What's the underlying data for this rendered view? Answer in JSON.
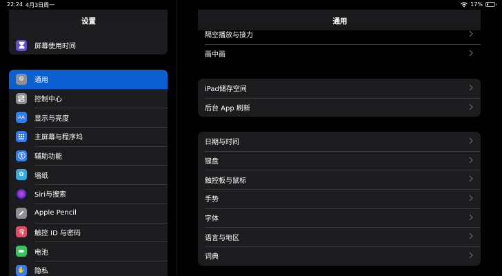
{
  "status": {
    "time": "22:24",
    "date": "4月3日周一",
    "battery": "17%"
  },
  "sidebar": {
    "title": "设置",
    "group1": [
      {
        "label": "屏幕使用时间",
        "icon": "hourglass-icon",
        "color": "#5e4fd4"
      }
    ],
    "group2": [
      {
        "label": "通用",
        "icon": "gear-icon",
        "color": "#8e8e93"
      },
      {
        "label": "控制中心",
        "icon": "switches-icon",
        "color": "#8e8e93"
      },
      {
        "label": "显示与亮度",
        "icon": "text-size-icon",
        "color": "#2f7ef5"
      },
      {
        "label": "主屏幕与程序坞",
        "icon": "grid-icon",
        "color": "#2f7ef5"
      },
      {
        "label": "辅助功能",
        "icon": "accessibility-icon",
        "color": "#2f7ef5"
      },
      {
        "label": "墙纸",
        "icon": "flower-icon",
        "color": "#35aadc"
      },
      {
        "label": "Siri与搜索",
        "icon": "siri-icon",
        "color": "#222"
      },
      {
        "label": "Apple Pencil",
        "icon": "pencil-icon",
        "color": "#8e8e93"
      },
      {
        "label": "触控 ID 与密码",
        "icon": "fingerprint-icon",
        "color": "#e94a5e"
      },
      {
        "label": "电池",
        "icon": "battery-icon",
        "color": "#34c759"
      },
      {
        "label": "隐私",
        "icon": "hand-icon",
        "color": "#2f7ef5"
      }
    ]
  },
  "detail": {
    "title": "通用",
    "group1": [
      "隔空播放与接力",
      "画中画"
    ],
    "group2": [
      "iPad储存空间",
      "后台 App 刷新"
    ],
    "group3": [
      "日期与时间",
      "键盘",
      "触控板与鼠标",
      "手势",
      "字体",
      "语言与地区",
      "词典"
    ]
  }
}
